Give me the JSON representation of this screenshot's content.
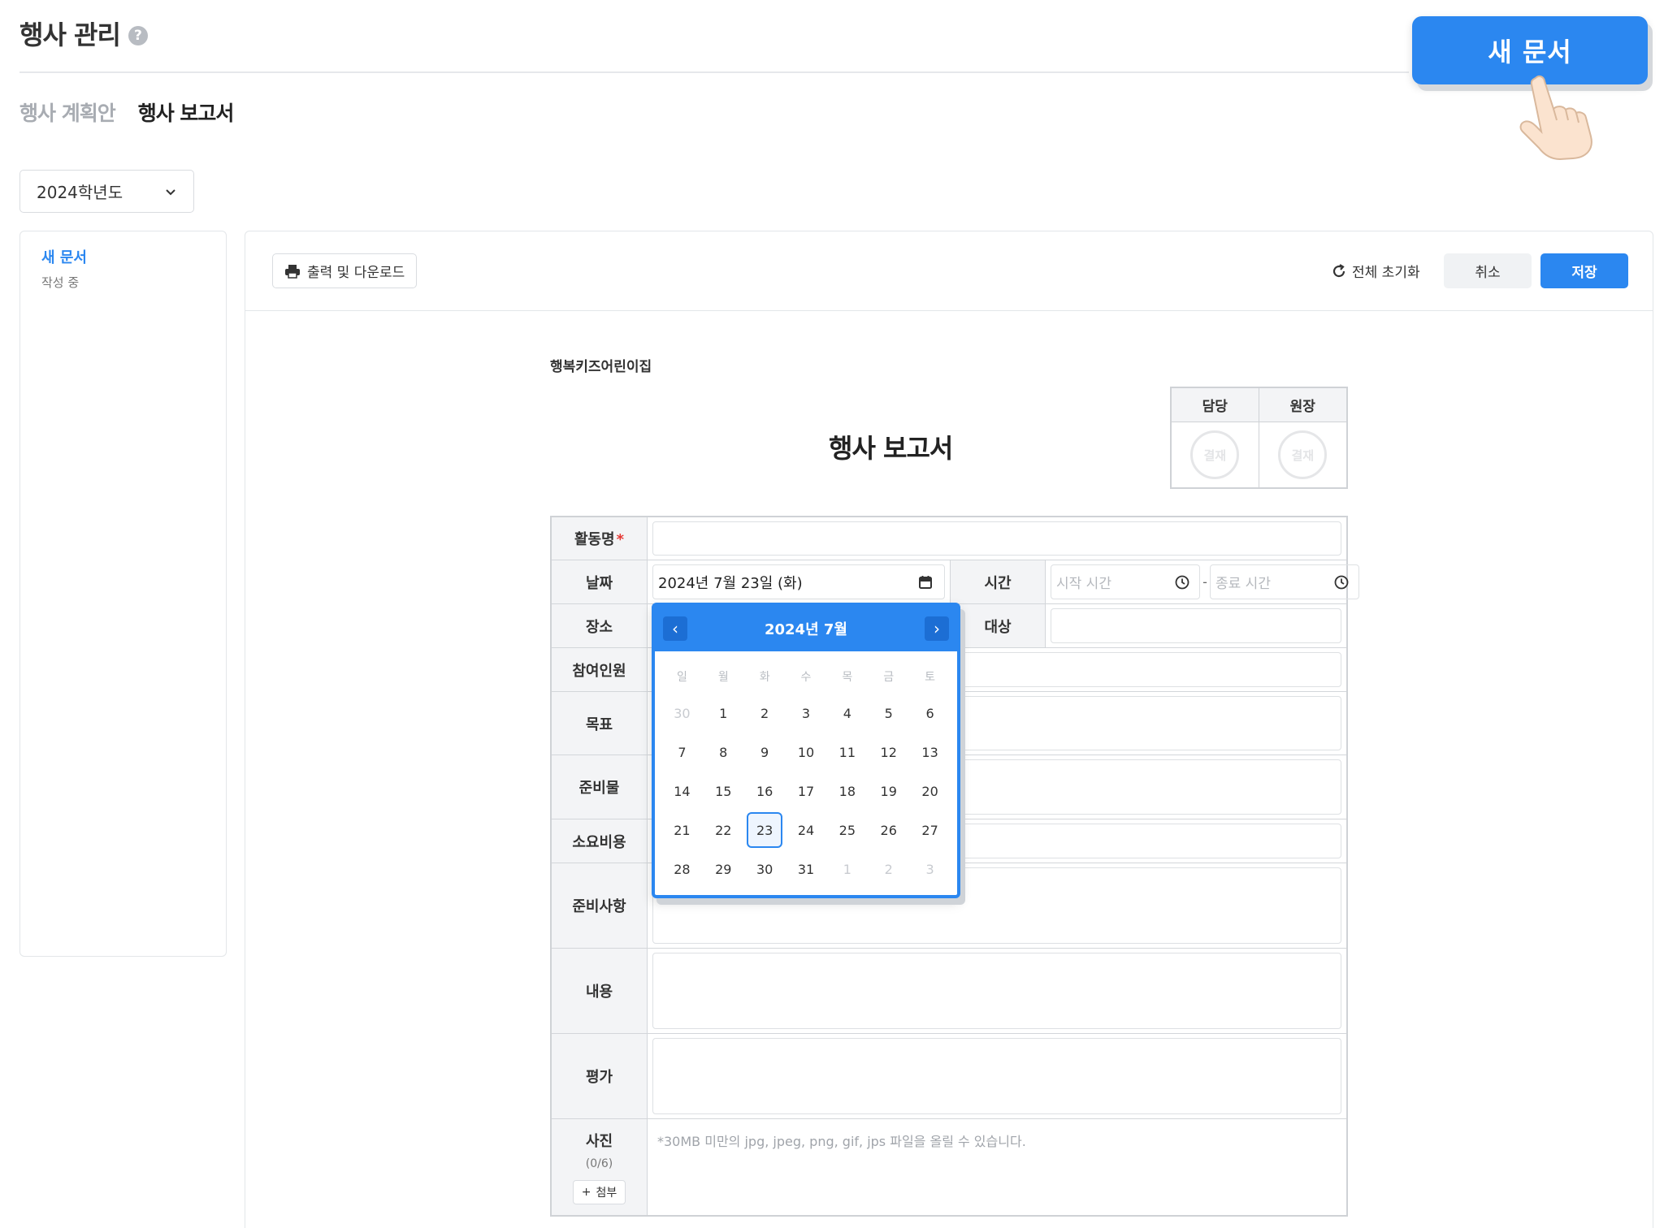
{
  "page": {
    "title": "행사 관리",
    "help_icon": "?"
  },
  "tabs": [
    {
      "label": "행사 계획안"
    },
    {
      "label": "행사 보고서"
    }
  ],
  "header": {
    "new_doc_label": "새 문서"
  },
  "year_select": {
    "value": "2024학년도"
  },
  "sidebar": {
    "item_title": "새 문서",
    "item_status": "작성 중"
  },
  "toolbar": {
    "print_label": "출력 및 다운로드",
    "reset_label": "전체 초기화",
    "cancel_label": "취소",
    "save_label": "저장"
  },
  "document": {
    "org_name": "행복키즈어린이집",
    "title": "행사 보고서",
    "approval": {
      "headers": [
        "담당",
        "원장"
      ],
      "stamp_label": "결재"
    }
  },
  "form": {
    "activity_label": "활동명",
    "required_mark": "*",
    "date_label": "날짜",
    "date_value": "2024년 7월 23일 (화)",
    "time_label": "시간",
    "start_time_placeholder": "시작 시간",
    "end_time_placeholder": "종료 시간",
    "time_separator": "-",
    "place_label": "장소",
    "target_label": "대상",
    "participants_label": "참여인원",
    "goal_label": "목표",
    "materials_label": "준비물",
    "cost_label": "소요비용",
    "prep_label": "준비사항",
    "content_label": "내용",
    "eval_label": "평가",
    "photo_label": "사진",
    "photo_count": "(0/6)",
    "attach_label": "첨부",
    "photo_hint": "*30MB 미만의 jpg, jpeg, png, gif, jps 파일을 올릴 수 있습니다."
  },
  "calendar": {
    "title": "2024년 7월",
    "prev": "‹",
    "next": "›",
    "weekdays": [
      "일",
      "월",
      "화",
      "수",
      "목",
      "금",
      "토"
    ],
    "days": [
      {
        "d": "30",
        "muted": true
      },
      {
        "d": "1"
      },
      {
        "d": "2"
      },
      {
        "d": "3"
      },
      {
        "d": "4"
      },
      {
        "d": "5"
      },
      {
        "d": "6"
      },
      {
        "d": "7"
      },
      {
        "d": "8"
      },
      {
        "d": "9"
      },
      {
        "d": "10"
      },
      {
        "d": "11"
      },
      {
        "d": "12"
      },
      {
        "d": "13"
      },
      {
        "d": "14"
      },
      {
        "d": "15"
      },
      {
        "d": "16"
      },
      {
        "d": "17"
      },
      {
        "d": "18"
      },
      {
        "d": "19"
      },
      {
        "d": "20"
      },
      {
        "d": "21"
      },
      {
        "d": "22"
      },
      {
        "d": "23",
        "selected": true
      },
      {
        "d": "24"
      },
      {
        "d": "25"
      },
      {
        "d": "26"
      },
      {
        "d": "27"
      },
      {
        "d": "28"
      },
      {
        "d": "29"
      },
      {
        "d": "30"
      },
      {
        "d": "31"
      },
      {
        "d": "1",
        "muted": true
      },
      {
        "d": "2",
        "muted": true
      },
      {
        "d": "3",
        "muted": true
      }
    ]
  },
  "colors": {
    "accent": "#2b87f0",
    "required": "#e53935"
  }
}
